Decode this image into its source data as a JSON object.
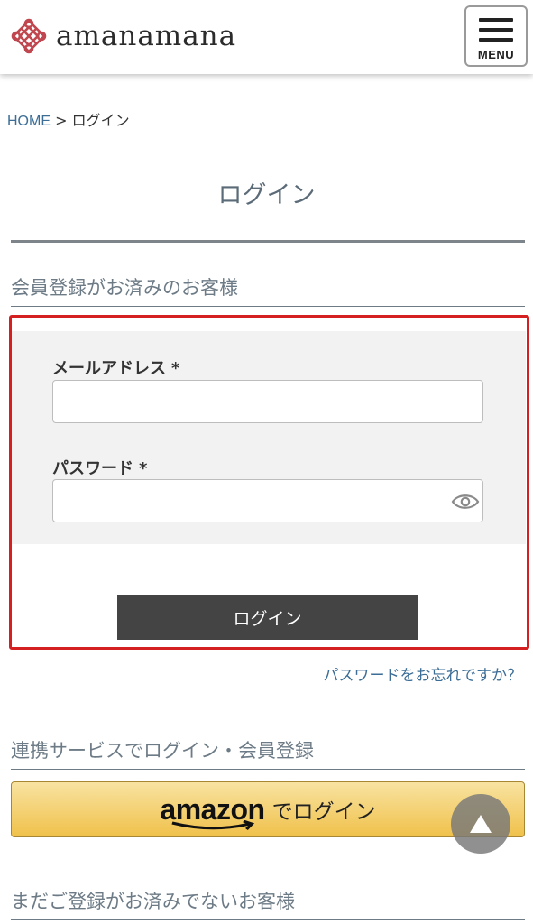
{
  "header": {
    "logo_text": "amanamana",
    "logo_icon": "knot-logo-icon",
    "menu_label": "MENU",
    "menu_icon": "hamburger-icon"
  },
  "breadcrumb": {
    "home": "HOME",
    "separator": ">",
    "current": "ログイン"
  },
  "page_title": "ログイン",
  "member_section": {
    "heading": "会員登録がお済みのお客様",
    "email_label": "メールアドレス",
    "email_value": "",
    "password_label": "パスワード",
    "password_value": "",
    "required_mark": "*",
    "password_toggle_icon": "eye-icon",
    "login_button": "ログイン",
    "forgot_link": "パスワードをお忘れですか？",
    "highlight_color": "#d42020"
  },
  "social_section": {
    "heading": "連携サービスでログイン・会員登録",
    "amazon_brand": "amazon",
    "amazon_button_text": "でログイン",
    "amazon_button_color": "#f0c14b"
  },
  "guest_section": {
    "heading": "まだご登録がお済みでないお客様"
  },
  "scroll_top_icon": "triangle-up-icon"
}
